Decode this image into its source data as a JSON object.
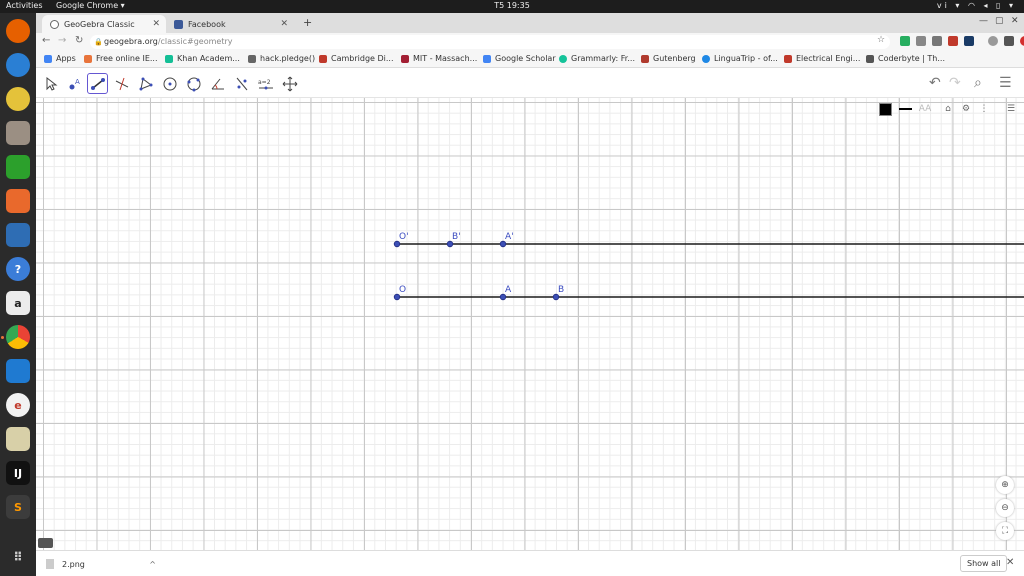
{
  "system_bar": {
    "activities": "Activities",
    "app_menu": "Google Chrome ▾",
    "clock": "T5 19:35",
    "lang": "vi ▾",
    "tray_icons": [
      "wifi-icon",
      "volume-icon",
      "battery-icon",
      "chevron-down-icon"
    ]
  },
  "dock": {
    "apps": [
      "firefox",
      "thunderbird",
      "rhythmbox",
      "files",
      "libreoffice-calc",
      "software-center",
      "libreoffice-writer",
      "help",
      "amazon",
      "chrome",
      "vscode",
      "geogebra",
      "text-editor",
      "intellij",
      "sublime",
      "app-grid"
    ]
  },
  "tabs": [
    {
      "label": "GeoGebra Classic",
      "active": true,
      "icon": "geogebra-icon"
    },
    {
      "label": "Facebook",
      "active": false,
      "icon": "facebook-icon"
    }
  ],
  "address": {
    "host": "geogebra.org",
    "path": "/classic#geometry"
  },
  "bookmarks": [
    {
      "label": "Apps",
      "icon": "apps-grid-icon",
      "color": "#4285f4"
    },
    {
      "label": "Free online IE...",
      "icon": "bookmark-icon",
      "color": "#e8743b"
    },
    {
      "label": "Khan Academ...",
      "icon": "khan-icon",
      "color": "#14bf96"
    },
    {
      "label": "hack.pledge()",
      "icon": "hand-icon",
      "color": "#666666"
    },
    {
      "label": "Cambridge Di...",
      "icon": "shield-icon",
      "color": "#c0392b"
    },
    {
      "label": "MIT - Massach...",
      "icon": "mit-icon",
      "color": "#a31f34"
    },
    {
      "label": "Google Scholar",
      "icon": "scholar-icon",
      "color": "#4285f4"
    },
    {
      "label": "Grammarly: Fr...",
      "icon": "grammarly-icon",
      "color": "#15c39a"
    },
    {
      "label": "Gutenberg",
      "icon": "book-icon",
      "color": "#b03a2e"
    },
    {
      "label": "LinguaTrip - of...",
      "icon": "globe-icon",
      "color": "#1e88e5"
    },
    {
      "label": "Electrical Engi...",
      "icon": "ee-icon",
      "color": "#c0392b"
    },
    {
      "label": "Coderbyte | Th...",
      "icon": "coderbyte-icon",
      "color": "#555555"
    }
  ],
  "geometry": {
    "points_top": [
      {
        "label": "O'"
      },
      {
        "label": "B'"
      },
      {
        "label": "A'"
      }
    ],
    "points_bottom": [
      {
        "label": "O"
      },
      {
        "label": "A"
      },
      {
        "label": "B"
      }
    ]
  },
  "style_bar": {
    "font_btn": "AA"
  },
  "download": {
    "file": "2.png",
    "show_all": "Show all"
  },
  "colors": {
    "point": "#3c4fb5",
    "label": "#3b4cc0",
    "ray": "#1a1a1a",
    "selected_tool": "#6557d2"
  }
}
